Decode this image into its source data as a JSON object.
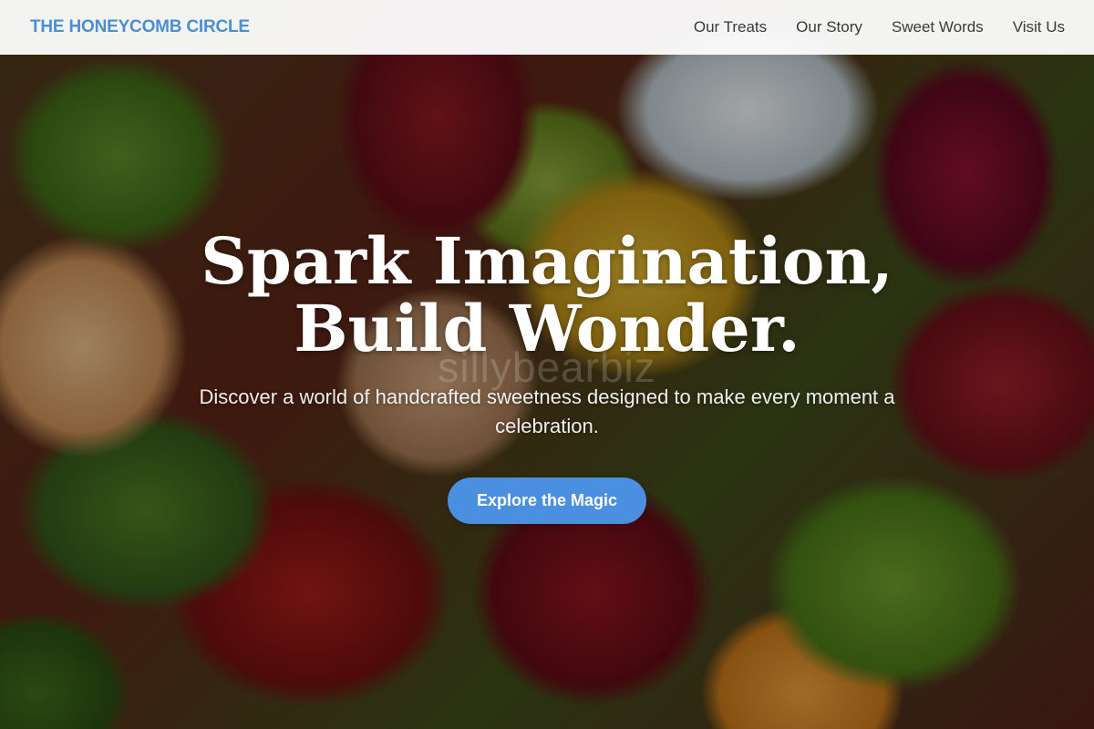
{
  "header": {
    "brand": "THE HONEYCOMB CIRCLE",
    "nav": [
      {
        "label": "Our Treats"
      },
      {
        "label": "Our Story"
      },
      {
        "label": "Sweet Words"
      },
      {
        "label": "Visit Us"
      }
    ]
  },
  "hero": {
    "title": "Spark Imagination, Build Wonder.",
    "subtitle": "Discover a world of handcrafted sweetness designed to make every moment a celebration.",
    "cta_label": "Explore the Magic",
    "watermark": "sillybearbiz"
  },
  "colors": {
    "accent": "#4a8fe0",
    "brand": "#4a8fd4",
    "nav_text": "#3a3a3a",
    "header_bg": "#fafafa"
  }
}
